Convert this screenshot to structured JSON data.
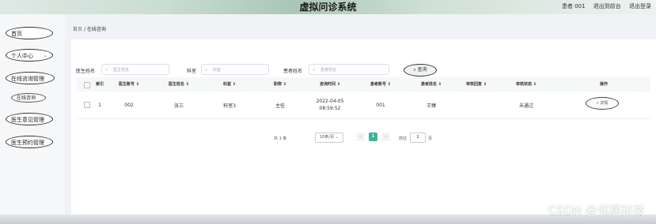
{
  "header": {
    "title": "虚拟问诊系统",
    "user": "患者 001",
    "back_link": "退出到前台",
    "logout": "退出登录"
  },
  "sidebar": {
    "items": [
      {
        "label": "首页"
      },
      {
        "label": "个人中心",
        "chevron": "⌄"
      },
      {
        "label": "在线咨询管理"
      },
      {
        "label": "在线咨询"
      },
      {
        "label": "医生意见管理"
      },
      {
        "label": "医生预约管理"
      }
    ]
  },
  "breadcrumb": {
    "home": "首页",
    "sep": "/",
    "current": "在线咨询"
  },
  "filters": {
    "doctor_label": "医生姓名",
    "doctor_placeholder": "医生姓名",
    "dept_label": "科室",
    "dept_placeholder": "科室",
    "patient_label": "患者姓名",
    "patient_placeholder": "患者姓名",
    "search_label": "查询",
    "search_icon": "⌕"
  },
  "table": {
    "headers": [
      "索引",
      "医生账号 ⇕",
      "医生姓名 ⇕",
      "科室 ⇕",
      "职称 ⇕",
      "咨询时间 ⇕",
      "患者账号 ⇕",
      "患者姓名 ⇕",
      "审核回复 ⇕",
      "审核状态 ⇕",
      "操作"
    ],
    "rows": [
      {
        "index": "1",
        "doctor_account": "002",
        "doctor_name": "张三",
        "dept": "科室3",
        "title": "主任",
        "time": "2022-04-05 08:59:52",
        "patient_account": "001",
        "patient_name": "王臻",
        "reply": "",
        "status": "未通过",
        "action": "详情"
      }
    ]
  },
  "pagination": {
    "total": "共 1 条",
    "page_size": "10条/页",
    "prev": "<",
    "page": "1",
    "next": ">",
    "goto_label": "前往",
    "goto_value": "1",
    "page_unit": "页"
  },
  "watermark": "CSDN @邻居科技"
}
